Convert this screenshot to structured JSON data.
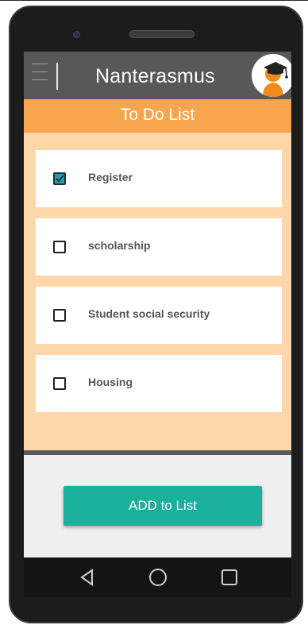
{
  "app": {
    "title": "Nanterasmus",
    "header": "To Do List"
  },
  "todo": {
    "items": [
      {
        "label": "Register",
        "checked": true
      },
      {
        "label": "scholarship",
        "checked": false
      },
      {
        "label": "Student social security",
        "checked": false
      },
      {
        "label": "Housing",
        "checked": false
      }
    ]
  },
  "actions": {
    "add_label": "ADD to List"
  },
  "nav": {
    "icons": [
      "back-triangle-icon",
      "home-circle-icon",
      "recents-square-icon"
    ]
  },
  "colors": {
    "app_bar": "#585858",
    "header": "#f7a64e",
    "list_background": "#fdd7aa",
    "button": "#1ab09b",
    "checkbox_checked": "#1b9fb0"
  }
}
